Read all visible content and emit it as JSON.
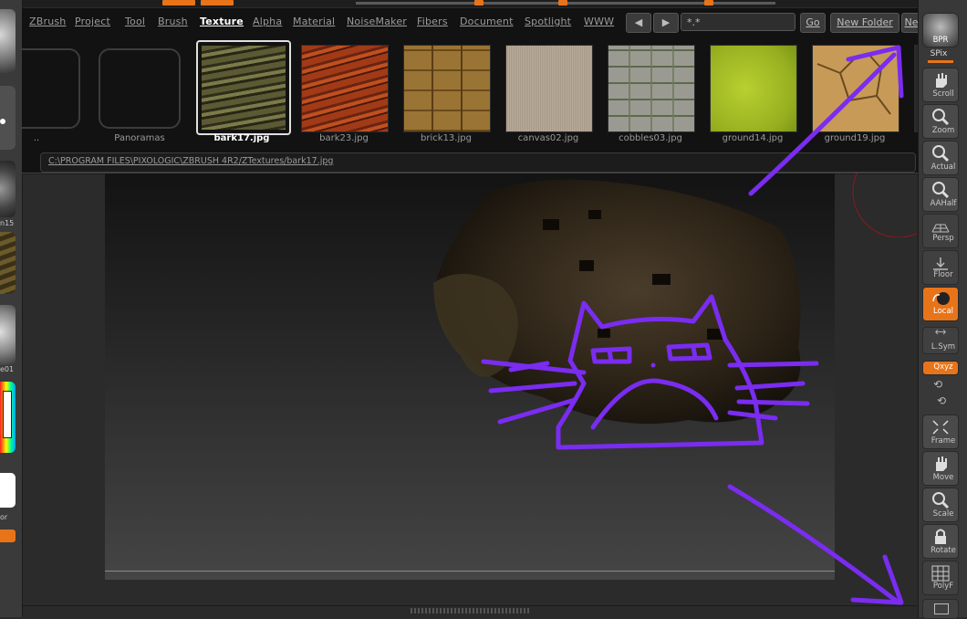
{
  "menu": [
    "ZBrush",
    "Project",
    "Tool",
    "Brush",
    "Texture",
    "Alpha",
    "Material",
    "NoiseMaker",
    "Fibers",
    "Document",
    "Spotlight",
    "WWW"
  ],
  "active_menu": "Texture",
  "nav": {
    "back_label": "◀",
    "forward_label": "▶",
    "filter_value": "*.*",
    "go_label": "Go",
    "new_folder_label": "New Folder",
    "ne_label": "Ne"
  },
  "folders": [
    {
      "label": ".."
    },
    {
      "label": "Panoramas"
    }
  ],
  "textures": [
    {
      "label": "bark17.jpg",
      "selected": true
    },
    {
      "label": "bark23.jpg"
    },
    {
      "label": "brick13.jpg"
    },
    {
      "label": "canvas02.jpg"
    },
    {
      "label": "cobbles03.jpg"
    },
    {
      "label": "ground14.jpg"
    },
    {
      "label": "ground19.jpg"
    }
  ],
  "path": "C:\\PROGRAM FILES\\PIXOLOGIC\\ZBRUSH 4R2/ZTextures/bark17.jpg",
  "right_shelf": {
    "bpr": "BPR",
    "spix": "SPix",
    "buttons": [
      "Scroll",
      "Zoom",
      "Actual",
      "AAHalf",
      "Persp",
      "Floor",
      "Local",
      "L.Sym",
      "Frame",
      "Move",
      "Scale",
      "Rotate",
      "PolyF"
    ],
    "xyz": "Qxyz"
  },
  "left_shelf": {
    "label_1": "n15",
    "label_2": "e01",
    "label_3": "or"
  },
  "colors": {
    "accent": "#e8741a",
    "doodle": "#7a2cf0"
  }
}
